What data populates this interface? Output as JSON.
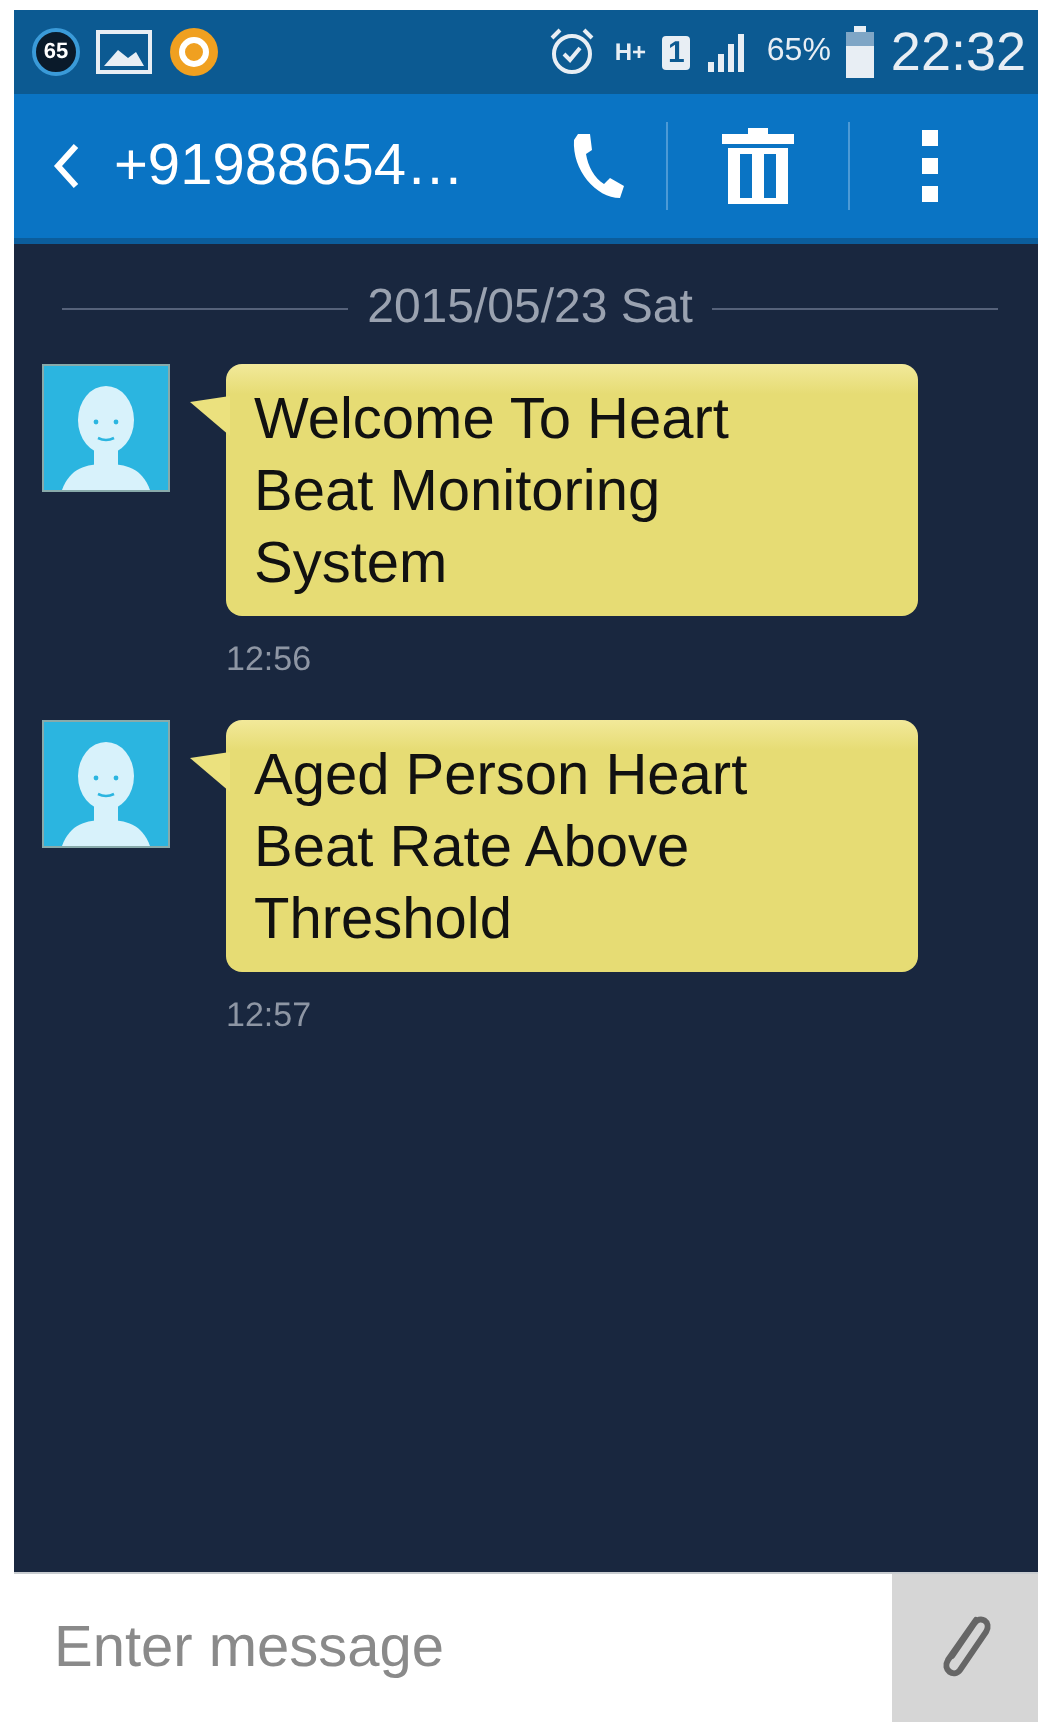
{
  "status_bar": {
    "notification_count": "65",
    "battery": "65%",
    "time": "22:32",
    "sim": "1",
    "network": "H+"
  },
  "header": {
    "contact": "+91988654…"
  },
  "conversation": {
    "date": "2015/05/23 Sat",
    "messages": [
      {
        "text": "Welcome To Heart Beat Monitoring System",
        "time": "12:56"
      },
      {
        "text": "Aged Person Heart Beat Rate Above Threshold",
        "time": "12:57"
      }
    ]
  },
  "composer": {
    "placeholder": "Enter message"
  }
}
